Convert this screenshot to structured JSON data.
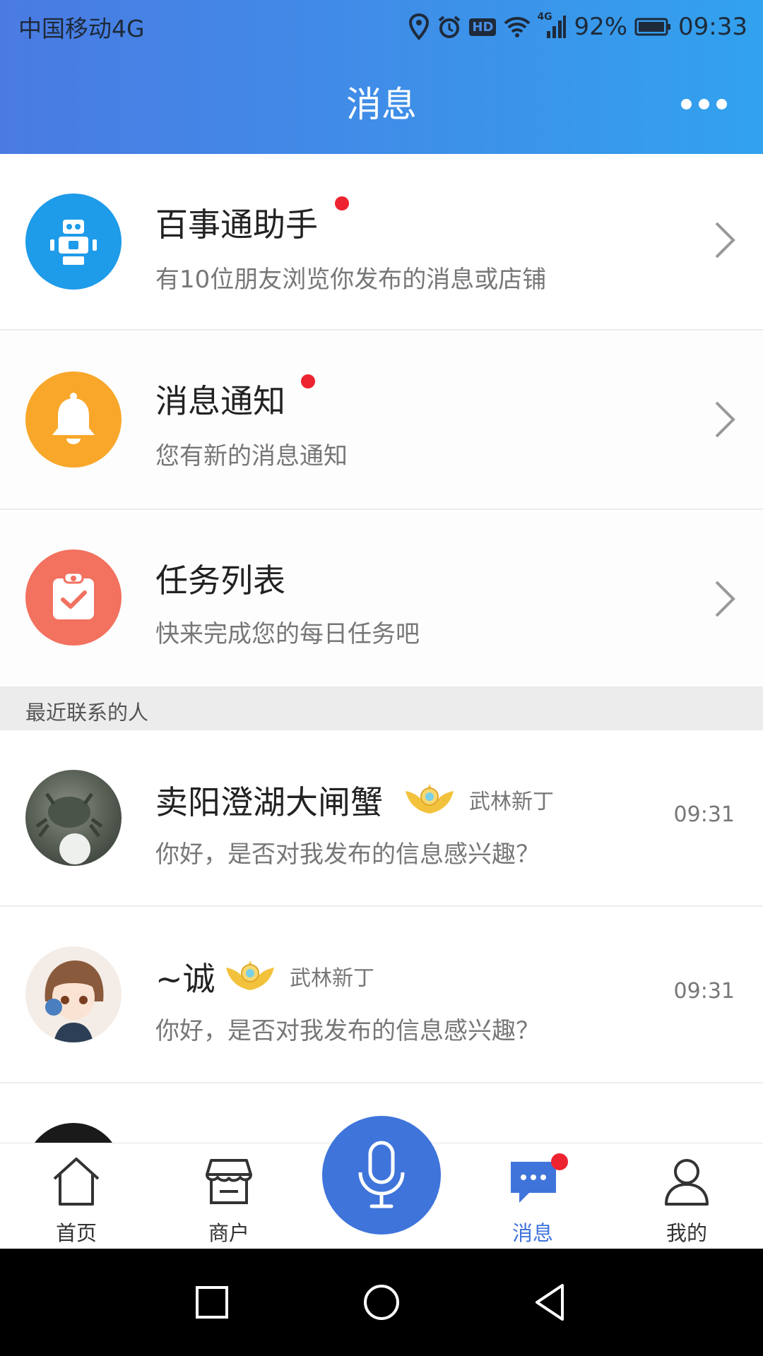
{
  "status_bar": {
    "carrier": "中国移动4G",
    "network_label": "4G",
    "hd_label": "HD",
    "battery": "92%",
    "time": "09:33"
  },
  "header": {
    "title": "消息"
  },
  "system_rows": [
    {
      "title": "百事通助手",
      "subtitle": "有10位朋友浏览你发布的消息或店铺",
      "icon": "robot-icon",
      "color": "#1e9be9",
      "unread": true
    },
    {
      "title": "消息通知",
      "subtitle": "您有新的消息通知",
      "icon": "bell-icon",
      "color": "#f9a72b",
      "unread": true
    },
    {
      "title": "任务列表",
      "subtitle": "快来完成您的每日任务吧",
      "icon": "clipboard-check-icon",
      "color": "#f2715f",
      "unread": false
    }
  ],
  "section": {
    "label": "最近联系的人"
  },
  "contacts": [
    {
      "name": "卖阳澄湖大闸蟹",
      "level": "武林新丁",
      "message": "你好，是否对我发布的信息感兴趣？",
      "time": "09:31"
    },
    {
      "name": "~诚",
      "level": "武林新丁",
      "message": "你好，是否对我发布的信息感兴趣？",
      "time": "09:31"
    }
  ],
  "tabs": [
    {
      "label": "首页",
      "icon": "home-icon"
    },
    {
      "label": "商户",
      "icon": "store-icon"
    },
    {
      "label": "消息",
      "icon": "chat-icon",
      "active": true,
      "unread": true
    },
    {
      "label": "我的",
      "icon": "user-icon"
    }
  ],
  "voice_button": {
    "icon": "microphone-icon"
  },
  "colors": {
    "accent": "#3f74db",
    "unread": "#ee2330"
  }
}
